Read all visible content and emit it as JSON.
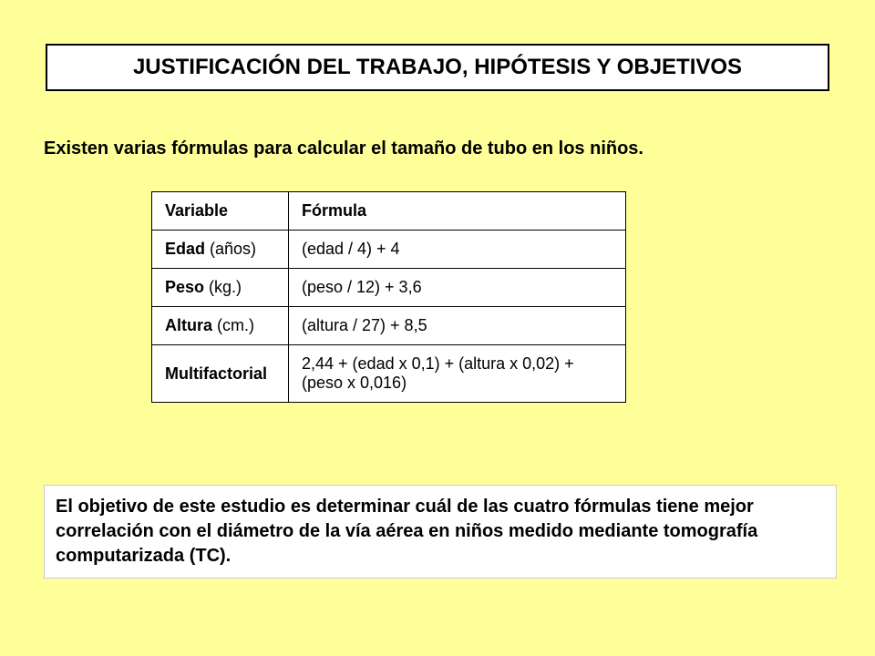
{
  "title": "JUSTIFICACIÓN DEL TRABAJO,  HIPÓTESIS Y OBJETIVOS",
  "intro": "Existen varias fórmulas para calcular el tamaño de tubo en los niños.",
  "table": {
    "header_variable": "Variable",
    "header_formula": "Fórmula",
    "rows": [
      {
        "label": "Edad",
        "unit": " (años)",
        "formula": "(edad / 4) + 4"
      },
      {
        "label": "Peso",
        "unit": " (kg.)",
        "formula": "(peso / 12) + 3,6"
      },
      {
        "label": "Altura",
        "unit": " (cm.)",
        "formula": "(altura / 27) + 8,5"
      },
      {
        "label": "Multifactorial",
        "unit": "",
        "formula": "2,44 + (edad x 0,1) + (altura x 0,02) + (peso x 0,016)"
      }
    ]
  },
  "objective": "El objetivo de este estudio es determinar cuál de las cuatro fórmulas tiene mejor correlación con el diámetro de la vía aérea en niños medido mediante tomografía computarizada (TC)."
}
